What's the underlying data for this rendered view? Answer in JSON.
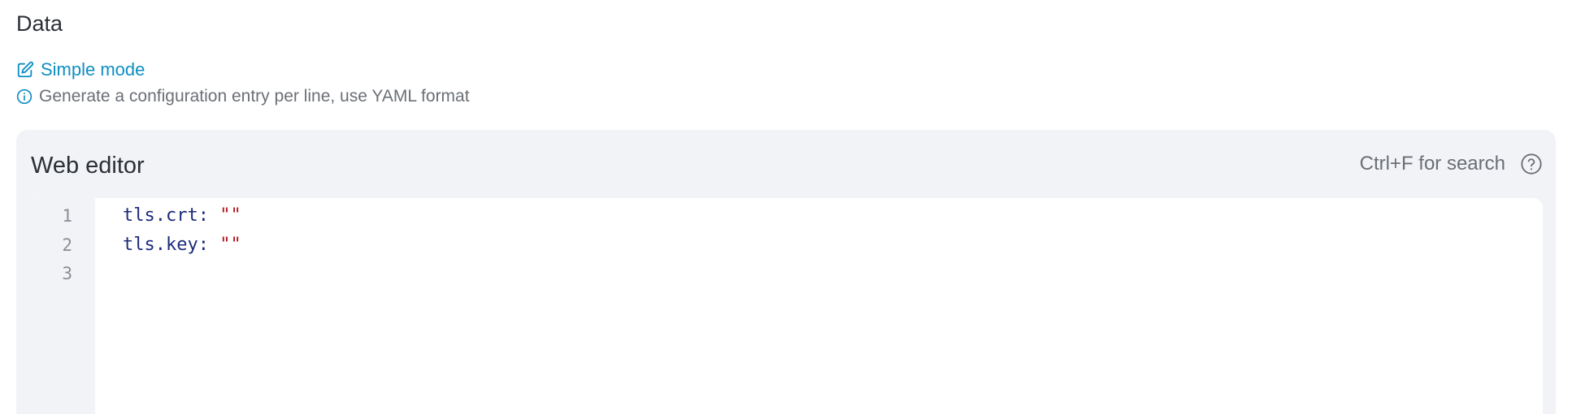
{
  "section": {
    "title": "Data"
  },
  "mode_link": {
    "label": "Simple mode",
    "icon": "edit-icon"
  },
  "hint": {
    "text": "Generate a configuration entry per line, use YAML format",
    "icon": "info-icon"
  },
  "editor": {
    "title": "Web editor",
    "search_hint": "Ctrl+F for search",
    "help_icon": "help-circle-icon",
    "line_numbers": [
      "1",
      "2",
      "3"
    ],
    "lines": [
      {
        "key": "tls.crt",
        "sep": ": ",
        "value": "\"\""
      },
      {
        "key": "tls.key",
        "sep": ": ",
        "value": "\"\""
      },
      {
        "key": "",
        "sep": "",
        "value": ""
      }
    ]
  },
  "colors": {
    "link": "#0e8ec2",
    "panel_bg": "#f2f3f6",
    "yaml_key": "#1d2a7a",
    "yaml_string": "#b5151b"
  }
}
